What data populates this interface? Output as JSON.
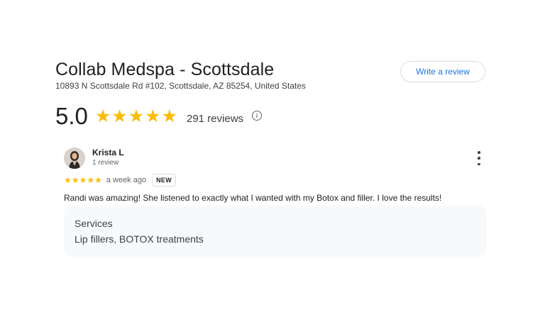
{
  "business": {
    "name": "Collab Medspa - Scottsdale",
    "address": "10893 N Scottsdale Rd #102, Scottsdale, AZ 85254, United States",
    "write_review_label": "Write a review",
    "rating": "5.0",
    "rating_stars": 5,
    "review_count": "291 reviews"
  },
  "review": {
    "author": "Krista L",
    "author_meta": "1 review",
    "stars": 5,
    "date": "a week ago",
    "badge": "NEW",
    "text": "Randi was amazing! She listened to exactly what I wanted with my Botox and filler. I love the results!",
    "services_label": "Services",
    "services_value": "Lip fillers, BOTOX treatments"
  },
  "icons": {
    "info": "info-icon",
    "more": "more-vert-icon",
    "star": "star-icon"
  },
  "colors": {
    "star": "#fbbc04",
    "link": "#1a73e8",
    "services_bg": "#f8f9fa"
  }
}
